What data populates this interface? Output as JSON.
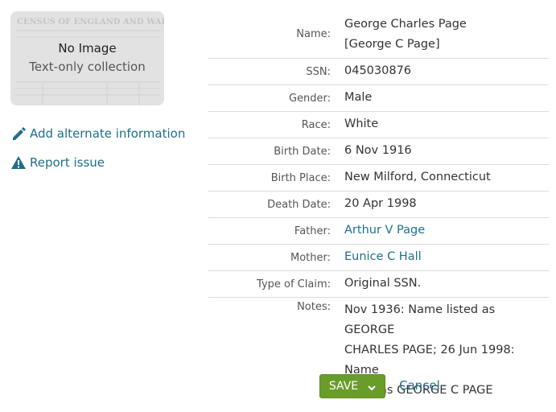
{
  "thumbnail": {
    "title": "No Image",
    "subtitle": "Text-only collection",
    "background_text": "CENSUS OF ENGLAND AND WALES"
  },
  "sidebar": {
    "add_alt_label": "Add alternate information",
    "report_label": "Report issue"
  },
  "record": {
    "name_label": "Name:",
    "name_line1": "George Charles Page",
    "name_line2": "[George C Page]",
    "ssn_label": "SSN:",
    "ssn": "045030876",
    "gender_label": "Gender:",
    "gender": "Male",
    "race_label": "Race:",
    "race": "White",
    "birth_date_label": "Birth Date:",
    "birth_date": "6 Nov 1916",
    "birth_place_label": "Birth Place:",
    "birth_place": "New Milford, Connecticut",
    "death_date_label": "Death Date:",
    "death_date": "20 Apr 1998",
    "father_label": "Father:",
    "father": "Arthur V Page",
    "mother_label": "Mother:",
    "mother": "Eunice C Hall",
    "claim_label": "Type of Claim:",
    "claim": "Original SSN.",
    "notes_label": "Notes:",
    "notes_line1": "Nov 1936: Name listed as GEORGE",
    "notes_line2": "CHARLES PAGE; 26 Jun 1998: Name",
    "notes_line3": "listed as GEORGE C PAGE"
  },
  "actions": {
    "save_label": "SAVE",
    "cancel_label": "Cancel"
  },
  "colors": {
    "link": "#1f6f8b",
    "save_button": "#6a9c2a"
  }
}
